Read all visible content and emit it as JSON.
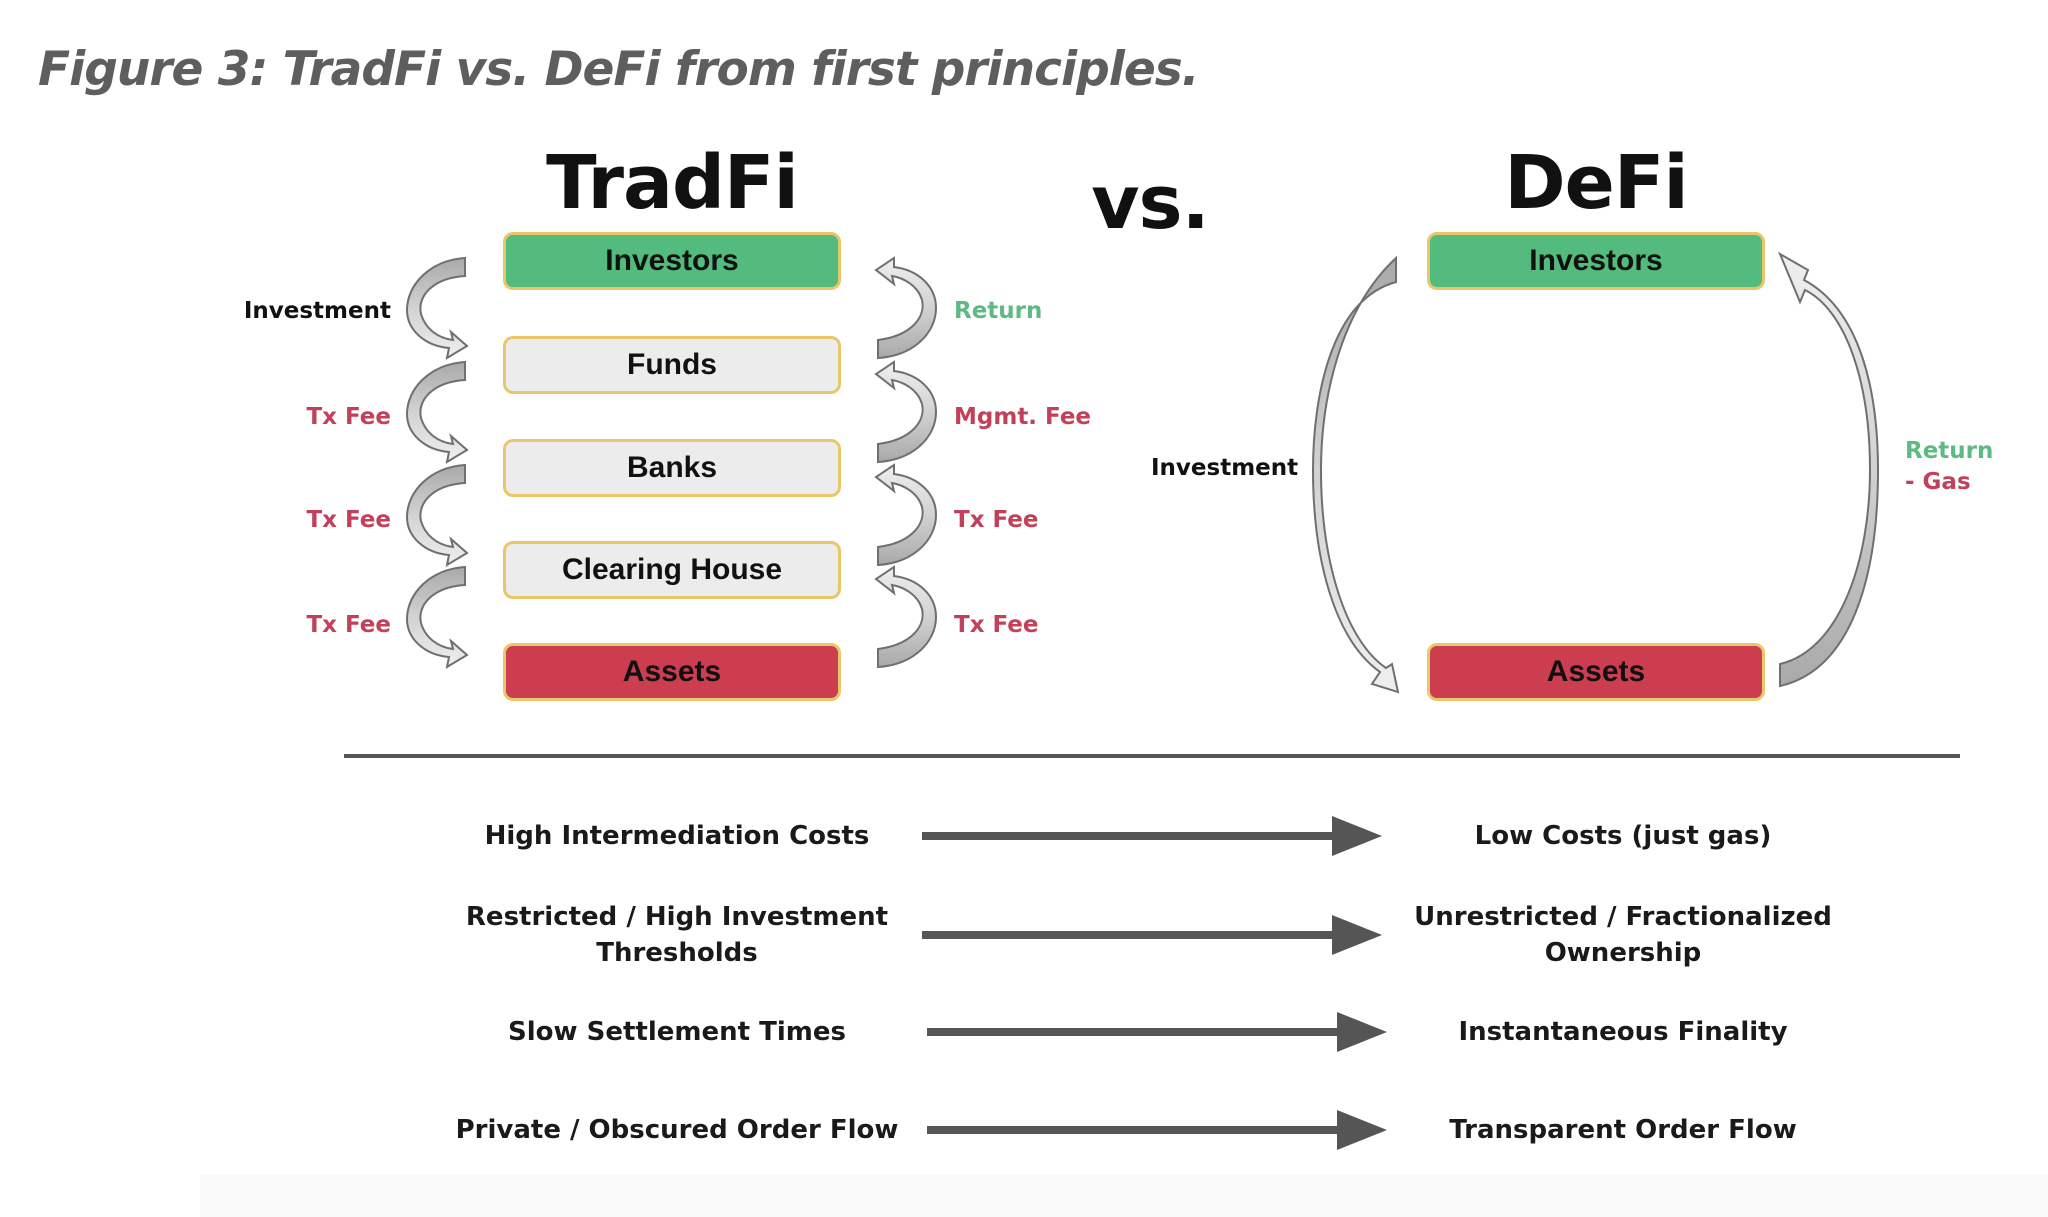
{
  "caption": "Figure 3: TradFi vs. DeFi from first principles.",
  "headings": {
    "tradfi": "TradFi",
    "vs": "vs.",
    "defi": "DeFi"
  },
  "colors": {
    "investors": "#52bb7d",
    "intermediary": "#ececec",
    "assets": "#cc3e4f",
    "box_border": "#e8c76a",
    "return_text": "#5fb983",
    "fee_text": "#c24059"
  },
  "tradfi": {
    "boxes": [
      {
        "label": "Investors",
        "kind": "green"
      },
      {
        "label": "Funds",
        "kind": "grey"
      },
      {
        "label": "Banks",
        "kind": "grey"
      },
      {
        "label": "Clearing House",
        "kind": "grey"
      },
      {
        "label": "Assets",
        "kind": "red"
      }
    ],
    "left_labels": [
      {
        "text": "Investment",
        "color": "black"
      },
      {
        "text": "Tx Fee",
        "color": "red"
      },
      {
        "text": "Tx Fee",
        "color": "red"
      },
      {
        "text": "Tx Fee",
        "color": "red"
      }
    ],
    "right_labels": [
      {
        "text": "Return",
        "color": "green"
      },
      {
        "text": "Mgmt. Fee",
        "color": "red"
      },
      {
        "text": "Tx Fee",
        "color": "red"
      },
      {
        "text": "Tx Fee",
        "color": "red"
      }
    ]
  },
  "defi": {
    "boxes": [
      {
        "label": "Investors",
        "kind": "green"
      },
      {
        "label": "Assets",
        "kind": "red"
      }
    ],
    "left_label": "Investment",
    "right_label_line1": "Return",
    "right_label_line2": "- Gas"
  },
  "comparisons": [
    {
      "tradfi": "High Intermediation Costs",
      "defi": "Low Costs (just gas)"
    },
    {
      "tradfi": "Restricted / High Investment\nThresholds",
      "defi": "Unrestricted / Fractionalized\nOwnership"
    },
    {
      "tradfi": "Slow Settlement Times",
      "defi": "Instantaneous Finality"
    },
    {
      "tradfi": "Private / Obscured Order Flow",
      "defi": "Transparent Order Flow"
    }
  ]
}
